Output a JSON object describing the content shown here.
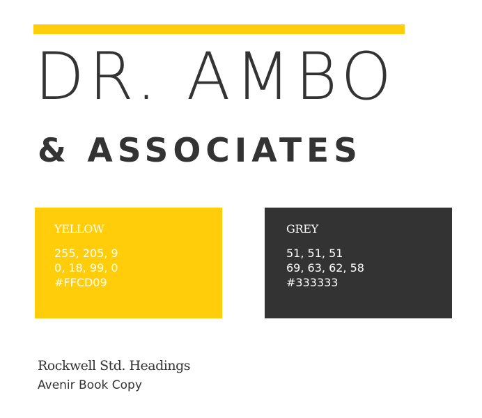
{
  "logo": {
    "title": "DR. AMBO",
    "subtitle": "& ASSOCIATES"
  },
  "swatches": [
    {
      "name": "YELLOW",
      "rgb": "255, 205, 9",
      "cmyk": "0, 18, 99, 0",
      "hex": "#FFCD09",
      "color": "#FFCD09"
    },
    {
      "name": "GREY",
      "rgb": "51, 51, 51",
      "cmyk": "69, 63, 62, 58",
      "hex": "#333333",
      "color": "#333333"
    }
  ],
  "typography": {
    "heading": "Rockwell Std. Headings",
    "copy": "Avenir Book Copy"
  },
  "colors": {
    "accent": "#FFCD09",
    "text": "#333333",
    "background": "#FFFFFF"
  }
}
